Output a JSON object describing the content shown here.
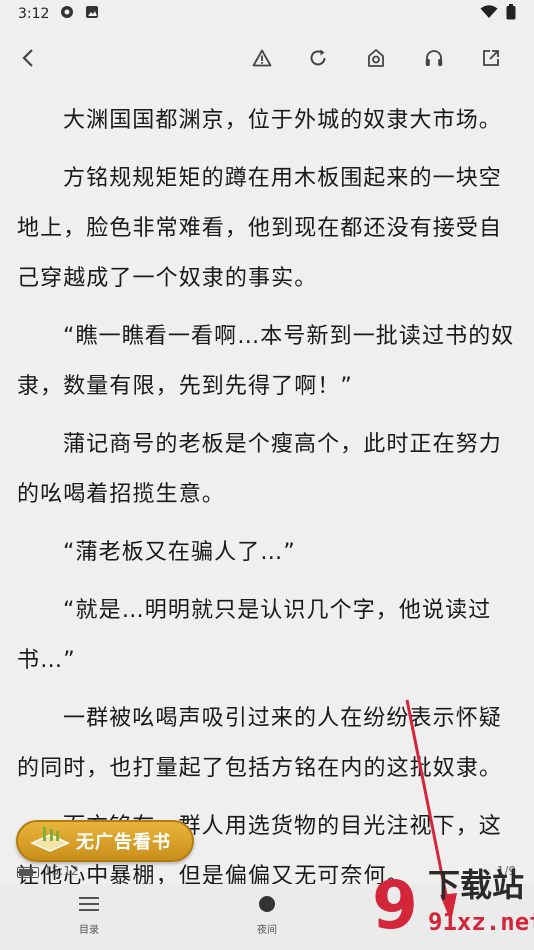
{
  "status_bar": {
    "time": "3:12"
  },
  "toolbar": {
    "back": "back-arrow-icon",
    "buttons": [
      "warning-icon",
      "refresh-icon",
      "camera-house-icon",
      "headphones-icon",
      "share-icon"
    ]
  },
  "content": {
    "paragraphs": [
      "大渊国国都渊京，位于外城的奴隶大市场。",
      "方铭规规矩矩的蹲在用木板围起来的一块空地上，脸色非常难看，他到现在都还没有接受自己穿越成了一个奴隶的事实。",
      "“瞧一瞧看一看啊…本号新到一批读过书的奴隶，数量有限，先到先得了啊！”",
      "蒲记商号的老板是个瘦高个，此时正在努力的吆喝着招揽生意。",
      "“蒲老板又在骗人了…”",
      "“就是…明明就只是认识几个字，他说读过书…”",
      "一群被吆喝声吸引过来的人在纷纷表示怀疑的同时，也打量起了包括方铭在内的这批奴隶。",
      "而方铭在一群人用选货物的目光注视下，这让他心中暴棚，但是偏偏又无可奈何。"
    ]
  },
  "promo": {
    "label": "无广告看书"
  },
  "footer_info": {
    "clock": "15:12",
    "page": "1/9",
    "battery_level": 0.75
  },
  "bottom_nav": {
    "catalog": "目录",
    "night": "夜间"
  },
  "watermark": {
    "line1": "下载站",
    "line2": "91xz.net"
  },
  "colors": {
    "background": "#efefef",
    "promo": "#d9a12b",
    "arrow": "#d3263a"
  }
}
